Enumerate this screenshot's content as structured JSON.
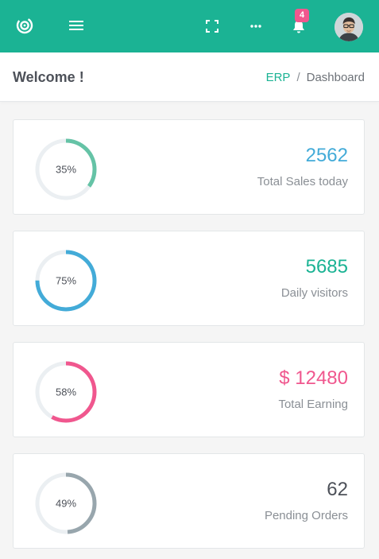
{
  "topbar": {
    "logo_icon": "target-logo-icon",
    "menu_icon": "hamburger-menu-icon",
    "fullscreen_icon": "fullscreen-icon",
    "more_icon": "more-dots-icon",
    "notification_icon": "bell-icon",
    "notification_count": "4",
    "avatar_icon": "user-avatar",
    "color": "#1bb394"
  },
  "header": {
    "title": "Welcome !",
    "breadcrumb": {
      "root": "ERP",
      "separator": "/",
      "current": "Dashboard"
    }
  },
  "cards": [
    {
      "percent": 35,
      "percent_label": "35%",
      "value": "2562",
      "label": "Total Sales today",
      "color": "#65c3a6",
      "value_color": "#43abd8"
    },
    {
      "percent": 75,
      "percent_label": "75%",
      "value": "5685",
      "label": "Daily visitors",
      "color": "#43abd8",
      "value_color": "#1bb394"
    },
    {
      "percent": 58,
      "percent_label": "58%",
      "value": "$ 12480",
      "label": "Total Earning",
      "color": "#f0578e",
      "value_color": "#f0578e"
    },
    {
      "percent": 49,
      "percent_label": "49%",
      "value": "62",
      "label": "Pending Orders",
      "color": "#98a6ad",
      "value_color": "#4d5159"
    }
  ]
}
